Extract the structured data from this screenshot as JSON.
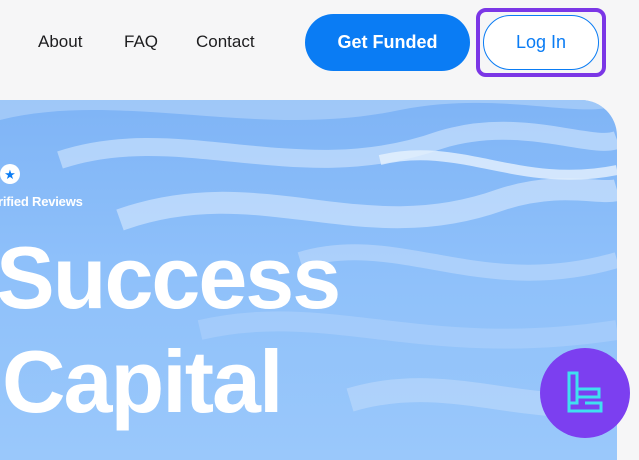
{
  "nav": {
    "links": [
      "About",
      "FAQ",
      "Contact"
    ],
    "get_funded_label": "Get Funded",
    "login_label": "Log In"
  },
  "hero": {
    "reviews_label": "erified Reviews",
    "headline_line1": "Success",
    "headline_line2": "Capital"
  },
  "colors": {
    "accent": "#0a7cf4",
    "highlight": "#7b36e6",
    "logo_bg": "#7c3ff0",
    "logo_mark": "#3fe0f0"
  },
  "icons": {
    "star": "star-icon",
    "logo": "tradingfinder-logo-icon"
  }
}
